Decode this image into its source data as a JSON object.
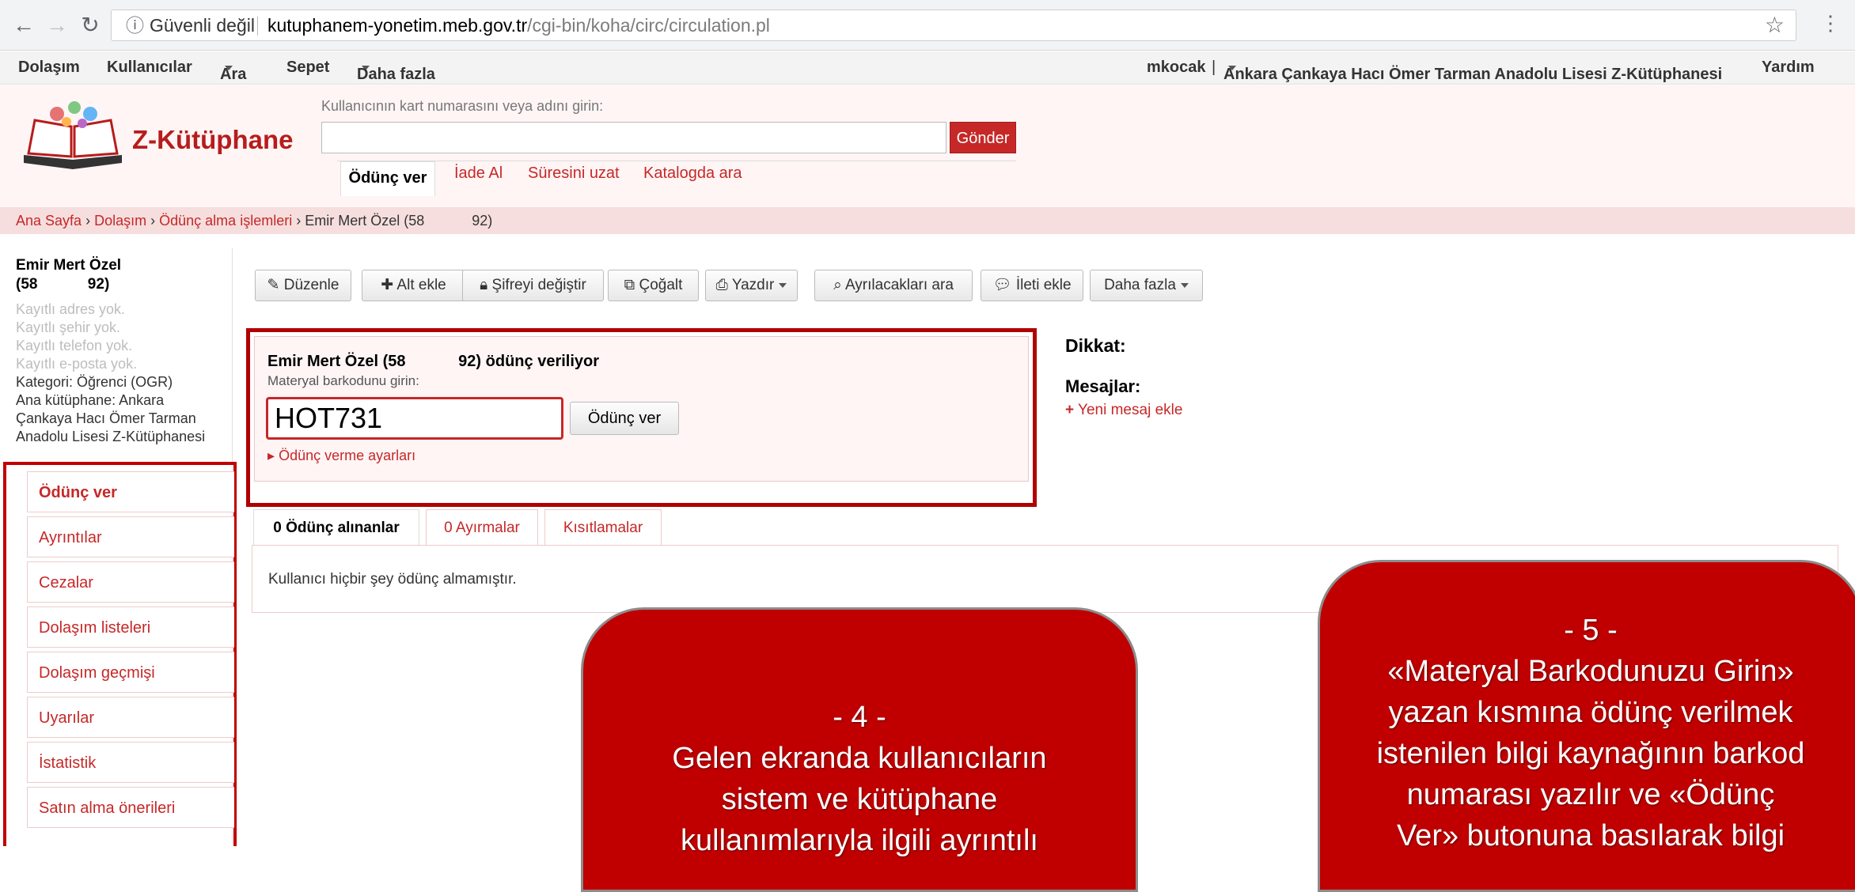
{
  "browser": {
    "security_label": "Güvenli değil",
    "url_host": "kutuphanem-yonetim.meb.gov.tr",
    "url_path": "/cgi-bin/koha/circ/circulation.pl"
  },
  "nav": {
    "items": [
      "Dolaşım",
      "Kullanıcılar",
      "Ara",
      "Sepet",
      "Daha fazla"
    ],
    "user": "mkocak",
    "separator": "|",
    "library": "Ankara Çankaya Hacı Ömer Tarman Anadolu Lisesi Z-Kütüphanesi",
    "help": "Yardım"
  },
  "header": {
    "logo_text": "Z-Kütüphane",
    "search_label": "Kullanıcının kart numarasını veya adını girin:",
    "search_value": "",
    "search_button": "Gönder",
    "tabs": [
      "Ödünç ver",
      "İade Al",
      "Süresini uzat",
      "Katalogda ara"
    ]
  },
  "breadcrumb": {
    "links": [
      "Ana Sayfa",
      "Dolaşım",
      "Ödünç alma işlemleri"
    ],
    "sep": "›",
    "current": "Emir Mert Özel (58            92)"
  },
  "patron": {
    "name": "Emir Mert Özel",
    "card": "(58            92)",
    "no_address": "Kayıtlı adres yok.",
    "no_city": "Kayıtlı şehir yok.",
    "no_phone": "Kayıtlı telefon yok.",
    "no_email": "Kayıtlı e-posta yok.",
    "category": "Kategori: Öğrenci (OGR)",
    "home_library_1": "Ana kütüphane: Ankara",
    "home_library_2": "Çankaya Hacı Ömer Tarman",
    "home_library_3": "Anadolu Lisesi Z-Kütüphanesi"
  },
  "sidebar_menu": [
    "Ödünç ver",
    "Ayrıntılar",
    "Cezalar",
    "Dolaşım listeleri",
    "Dolaşım geçmişi",
    "Uyarılar",
    "İstatistik",
    "Satın alma önerileri"
  ],
  "toolbar": [
    "Düzenle",
    "Alt ekle",
    "Şifreyi değiştir",
    "Çoğalt",
    "Yazdır",
    "Ayrılacakları ara",
    "İleti ekle",
    "Daha fazla"
  ],
  "checkout": {
    "title": "Emir Mert Özel (58            92) ödünç veriliyor",
    "label": "Materyal barkodunu girin:",
    "value": "HOT731",
    "button": "Ödünç ver",
    "settings": "Ödünç verme ayarları"
  },
  "messages": {
    "attention": "Dikkat:",
    "title": "Mesajlar:",
    "new_message": "Yeni mesaj ekle"
  },
  "tabs": {
    "items": [
      "0 Ödünç alınanlar",
      "0 Ayırmalar",
      "Kısıtlamalar"
    ],
    "panel_text": "Kullanıcı hiçbir şey ödünç almamıştır."
  },
  "callouts": {
    "step4": {
      "number": "- 4 -",
      "text_1": "Gelen ekranda kullanıcıların",
      "text_2": "sistem ve kütüphane",
      "text_3": "kullanımlarıyla ilgili ayrıntılı"
    },
    "step5": {
      "number": "- 5 -",
      "text_1": "«Materyal Barkodunuzu Girin»",
      "text_2": "yazan kısmına ödünç verilmek",
      "text_3": "istenilen bilgi kaynağının barkod",
      "text_4": "numarası yazılır ve «Ödünç",
      "text_5": "Ver» butonuna basılarak bilgi"
    }
  },
  "colors": {
    "accent": "#c62828",
    "frame": "#b00000",
    "callout": "#c00000",
    "header_bg": "#fff5f5"
  }
}
